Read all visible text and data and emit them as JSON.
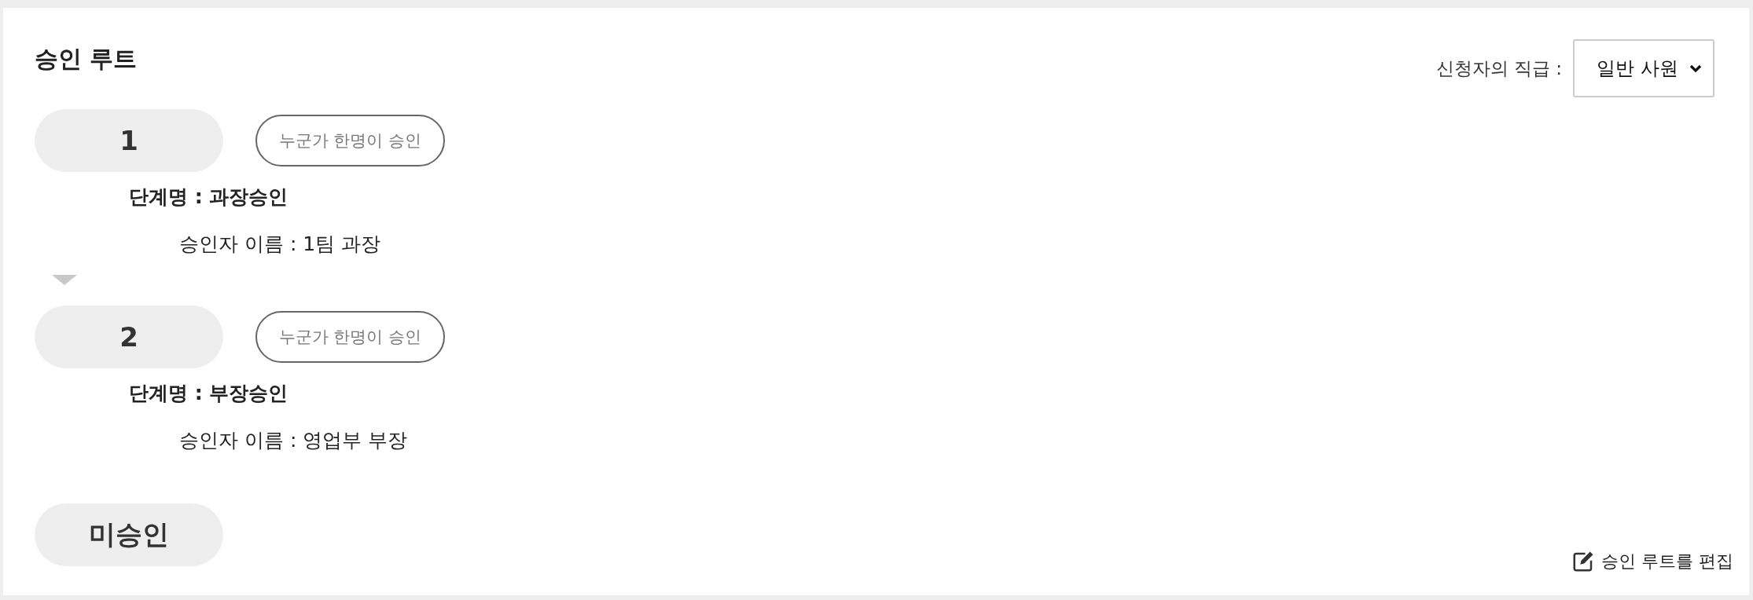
{
  "title": "승인 루트",
  "applicant_rank": {
    "label": "신청자의 직급 :",
    "value": "일반 사원"
  },
  "steps": [
    {
      "kind": "step",
      "badge": "1",
      "mode": "누군가 한명이 승인",
      "stage_name": "단계명 : 과장승인",
      "approver": "승인자 이름 : 1팀 과장"
    },
    {
      "kind": "step",
      "badge": "2",
      "mode": "누군가 한명이 승인",
      "stage_name": "단계명 : 부장승인",
      "approver": "승인자 이름 : 영업부 부장"
    },
    {
      "kind": "status",
      "badge": "미승인"
    }
  ],
  "edit_link": "승인 루트를 편집"
}
